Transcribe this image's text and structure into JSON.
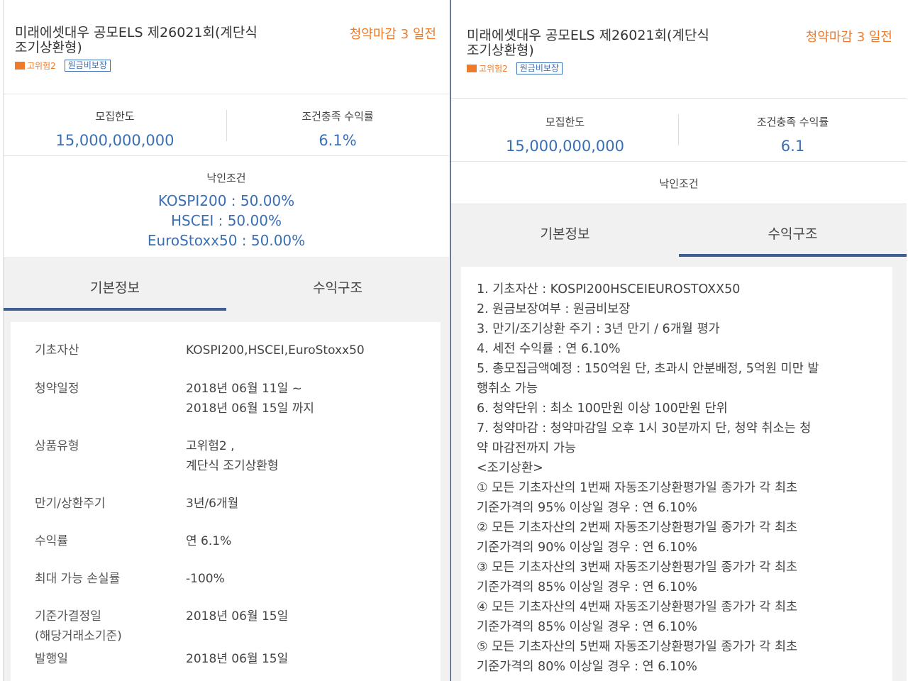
{
  "left": {
    "title_line1": "미래에셋대우 공모ELS 제26021회(계단식",
    "title_line2": "조기상환형)",
    "deadline": "청약마감 3 일전",
    "risk_label": "고위험2",
    "principal_badge": "원금비보장",
    "stats": [
      {
        "label": "모집한도",
        "value": "15,000,000,000"
      },
      {
        "label": "조건충족 수익률",
        "value": "6.1%"
      }
    ],
    "knockin_label": "낙인조건",
    "knockin_values": [
      "KOSPI200 : 50.00%",
      "HSCEI : 50.00%",
      "EuroStoxx50 : 50.00%"
    ],
    "tabs": [
      "기본정보",
      "수익구조"
    ],
    "details": [
      {
        "key": "기초자산",
        "value": [
          "KOSPI200,HSCEI,EuroStoxx50"
        ]
      },
      {
        "key": "청약일정",
        "value": [
          "2018년 06월 11일 ~",
          "2018년 06월 15일 까지"
        ]
      },
      {
        "key": "상품유형",
        "value": [
          "고위험2 ,",
          "계단식 조기상환형"
        ]
      },
      {
        "key": "만기/상환주기",
        "value": [
          "3년/6개월"
        ]
      },
      {
        "key": "수익률",
        "value": [
          "연 6.1%"
        ]
      },
      {
        "key": "최대 가능 손실률",
        "value": [
          "-100%"
        ]
      },
      {
        "key": "기준가결정일",
        "key2": "(해당거래소기준)",
        "value": [
          "2018년 06월 15일"
        ]
      },
      {
        "key": "발행일",
        "value": [
          "2018년 06월 15일"
        ]
      }
    ]
  },
  "right": {
    "title_line1": "미래에셋대우 공모ELS 제26021회(계단식",
    "title_line2": "조기상환형)",
    "deadline": "청약마감 3 일전",
    "risk_label": "고위험2",
    "principal_badge": "원금비보장",
    "stats": [
      {
        "label": "모집한도",
        "value": "15,000,000,000"
      },
      {
        "label": "조건충족 수익률",
        "value": "6.1"
      }
    ],
    "knockin_label": "낙인조건",
    "tabs": [
      "기본정보",
      "수익구조"
    ],
    "structure_lines": [
      "1. 기초자산 : KOSPI200HSCEIEUROSTOXX50",
      "2. 원금보장여부 :  원금비보장",
      "3. 만기/조기상환 주기 : 3년 만기 / 6개월 평가",
      "4. 세전 수익률 : 연 6.10%",
      "5. 총모집금액예정 : 150억원 단, 초과시 안분배정, 5억원 미만 발",
      "행취소 가능",
      "6. 청약단위 : 최소 100만원 이상 100만원 단위",
      "7. 청약마감 :  청약마감일 오후 1시 30분까지 단, 청약 취소는 청",
      "약 마감전까지 가능",
      "<조기상환>",
      "① 모든 기초자산의 1번째 자동조기상환평가일 종가가 각 최초",
      "기준가격의 95% 이상일 경우 : 연 6.10%",
      "② 모든 기초자산의 2번째 자동조기상환평가일 종가가 각 최초",
      "기준가격의 90% 이상일 경우 : 연 6.10%",
      "③ 모든 기초자산의 3번째 자동조기상환평가일 종가가 각 최초",
      "기준가격의 85% 이상일 경우 : 연 6.10%",
      "④ 모든 기초자산의 4번째 자동조기상환평가일 종가가 각 최초",
      "기준가격의 85% 이상일 경우 : 연 6.10%",
      "⑤ 모든 기초자산의 5번째 자동조기상환평가일 종가가 각 최초",
      "기준가격의 80% 이상일 경우 : 연 6.10%"
    ]
  }
}
